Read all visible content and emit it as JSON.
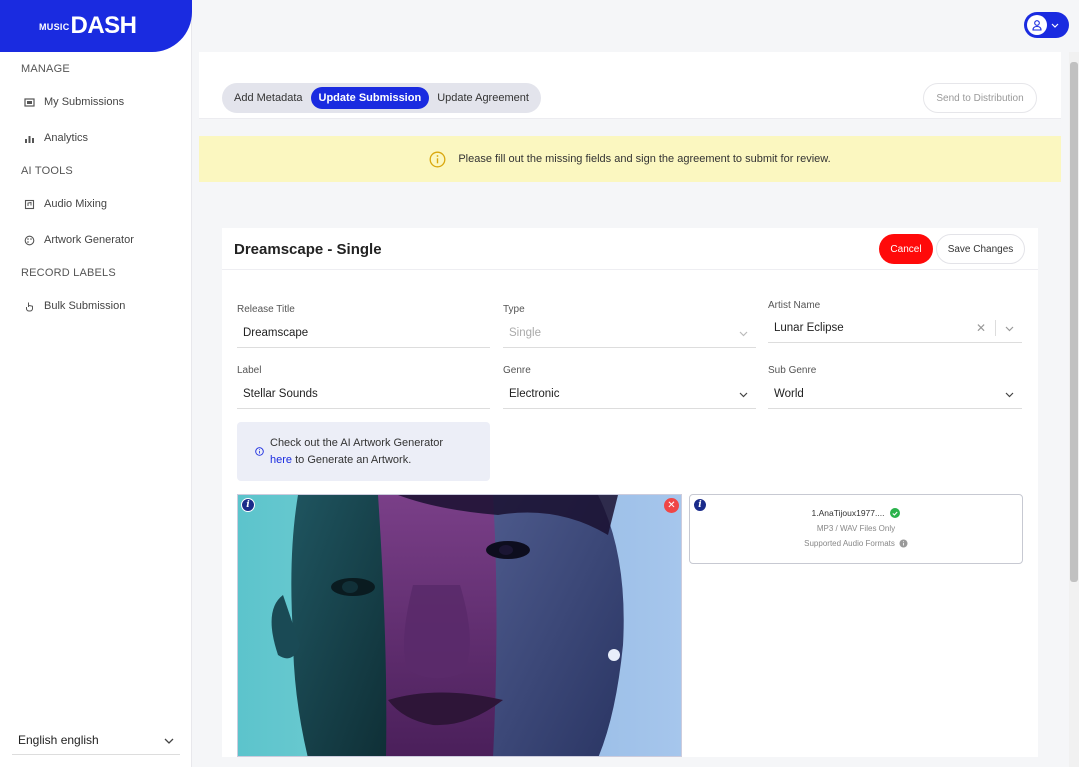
{
  "brand": {
    "small": "MUSIC",
    "big": "DASH"
  },
  "sidebar": {
    "sections": [
      {
        "title": "MANAGE"
      },
      {
        "title": "AI TOOLS"
      },
      {
        "title": "RECORD LABELS"
      }
    ],
    "items": [
      {
        "label": "My Submissions",
        "icon": "film-icon"
      },
      {
        "label": "Analytics",
        "icon": "bar-chart-icon"
      },
      {
        "label": "Audio Mixing",
        "icon": "audio-file-icon"
      },
      {
        "label": "Artwork Generator",
        "icon": "palette-icon"
      },
      {
        "label": "Bulk Submission",
        "icon": "hand-pointer-icon"
      }
    ],
    "language": "English english"
  },
  "toolbar": {
    "tabs": [
      {
        "label": "Add Metadata",
        "active": false
      },
      {
        "label": "Update Submission",
        "active": true
      },
      {
        "label": "Update Agreement",
        "active": false
      }
    ],
    "send_label": "Send to Distribution"
  },
  "banner": {
    "text": "Please fill out the missing fields and sign the agreement to submit for review."
  },
  "card": {
    "title": "Dreamscape - Single",
    "cancel_label": "Cancel",
    "save_label": "Save Changes"
  },
  "form": {
    "release_title": {
      "label": "Release Title",
      "value": "Dreamscape"
    },
    "type": {
      "label": "Type",
      "value": "Single"
    },
    "artist_name": {
      "label": "Artist Name",
      "value": "Lunar Eclipse"
    },
    "label": {
      "label": "Label",
      "value": "Stellar Sounds"
    },
    "genre": {
      "label": "Genre",
      "value": "Electronic"
    },
    "sub_genre": {
      "label": "Sub Genre",
      "value": "World"
    }
  },
  "tip": {
    "line1": "Check out the AI Artwork Generator",
    "link": "here",
    "line2": " to Generate an Artwork."
  },
  "audio": {
    "file_name": "1.AnaTijoux1977....",
    "formats_note": "MP3 / WAV Files Only",
    "supported_label": "Supported Audio Formats"
  },
  "colors": {
    "accent": "#1a2be0",
    "cancel": "#ff0a0a",
    "banner": "#fbf7c0",
    "success": "#2bb24c"
  }
}
